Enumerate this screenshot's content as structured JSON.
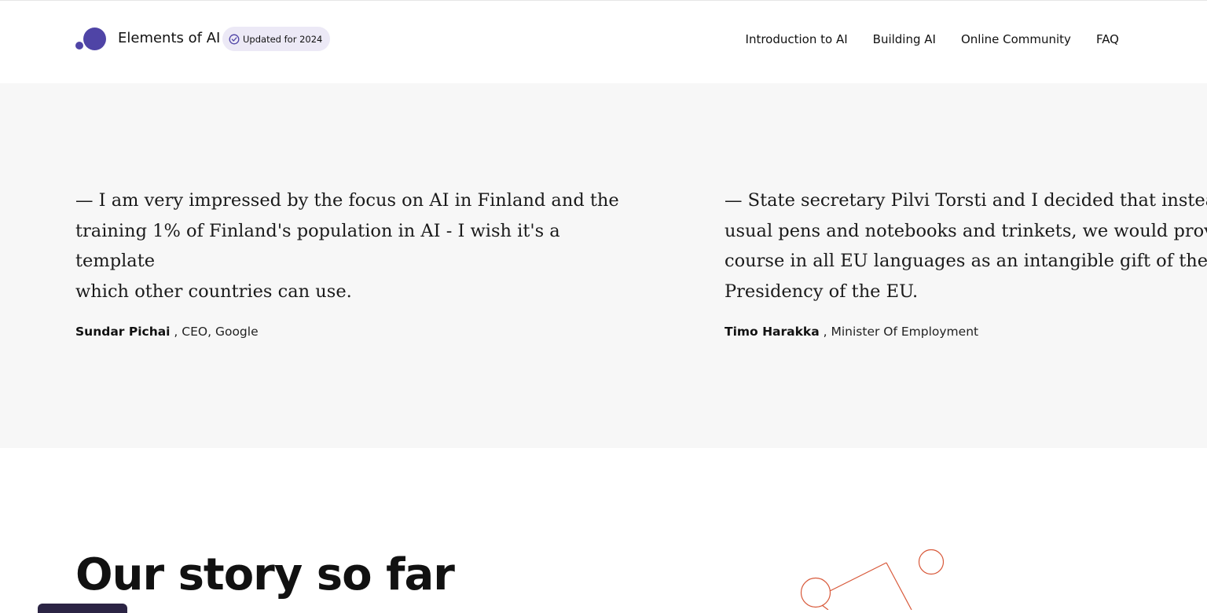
{
  "colors": {
    "accent": "#4f44a6",
    "illustration_stroke": "#d8593a",
    "band_background": "#f7f7f7"
  },
  "header": {
    "brand": "Elements of AI",
    "badge": {
      "icon": "check-circle-icon",
      "label": "Updated for 2024"
    },
    "nav": [
      {
        "label": "Introduction to AI"
      },
      {
        "label": "Building AI"
      },
      {
        "label": "Online Community"
      },
      {
        "label": "FAQ"
      }
    ]
  },
  "testimonials": [
    {
      "lines": [
        "— I am very impressed by the focus on AI in Finland and the",
        "training 1% of Finland's population in AI - I wish it's a template",
        "which other countries can use."
      ],
      "author": "Sundar Pichai",
      "role": " , CEO, Google"
    },
    {
      "lines": [
        "— State secretary Pilvi Torsti and I decided that instead",
        "usual pens and notebooks and trinkets, we would provi",
        "course in all EU languages as an intangible gift of the Fi",
        "Presidency of the EU."
      ],
      "author": "Timo Harakka",
      "role": " , Minister Of Employment"
    }
  ],
  "story": {
    "title": "Our story so far"
  }
}
